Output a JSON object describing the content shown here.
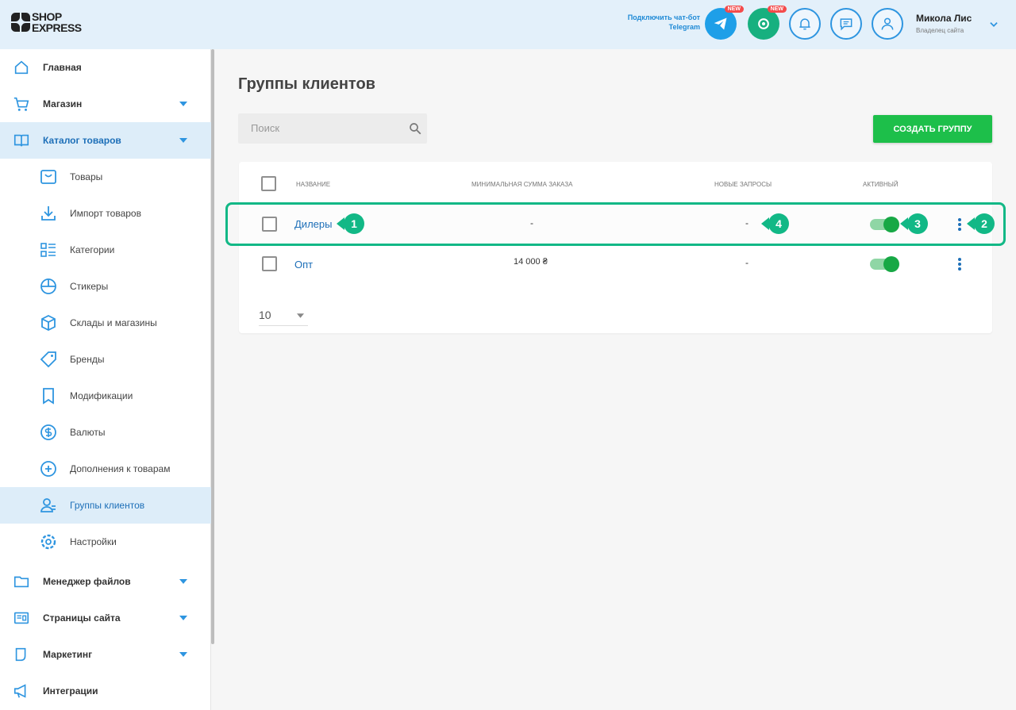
{
  "header": {
    "logo_line1": "SHOP",
    "logo_line2": "EXPRESS",
    "telegram_line1": "Подключить чат-бот",
    "telegram_line2": "Telegram",
    "new_badge": "NEW",
    "user_name": "Микола Лис",
    "user_role": "Владелец сайта"
  },
  "sidebar": {
    "items": [
      {
        "label": "Главная"
      },
      {
        "label": "Магазин"
      },
      {
        "label": "Каталог товаров"
      },
      {
        "label": "Товары"
      },
      {
        "label": "Импорт товаров"
      },
      {
        "label": "Категории"
      },
      {
        "label": "Стикеры"
      },
      {
        "label": "Склады и магазины"
      },
      {
        "label": "Бренды"
      },
      {
        "label": "Модификации"
      },
      {
        "label": "Валюты"
      },
      {
        "label": "Дополнения к товарам"
      },
      {
        "label": "Группы клиентов"
      },
      {
        "label": "Настройки"
      },
      {
        "label": "Менеджер файлов"
      },
      {
        "label": "Страницы сайта"
      },
      {
        "label": "Маркетинг"
      },
      {
        "label": "Интеграции"
      }
    ]
  },
  "main": {
    "title": "Группы клиентов",
    "search_placeholder": "Поиск",
    "create_button": "Создать группу",
    "columns": [
      "Название",
      "Минимальная сумма заказа",
      "Новые запросы",
      "Активный"
    ],
    "rows": [
      {
        "name": "Дилеры",
        "min_sum": "-",
        "new_requests": "-",
        "active": true
      },
      {
        "name": "Опт",
        "min_sum": "14 000 ₴",
        "new_requests": "-",
        "active": true
      }
    ],
    "per_page": "10"
  },
  "annotations": [
    "1",
    "2",
    "3",
    "4"
  ],
  "colors": {
    "accent": "#1d6fb8",
    "primary_button": "#1dbf4a",
    "highlight": "#12b886",
    "header_bg": "#e3f0fa"
  }
}
